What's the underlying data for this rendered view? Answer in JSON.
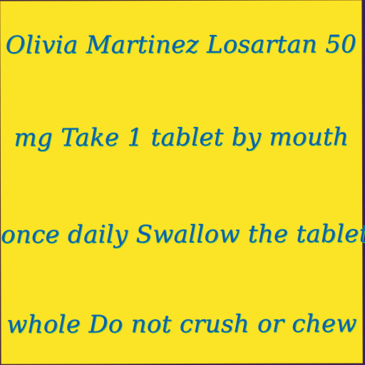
{
  "label": {
    "lines": [
      "Olivia Martinez Losartan 50",
      "mg Take 1 tablet by mouth",
      "once daily Swallow the tablet",
      "whole Do not crush or chew"
    ]
  },
  "colors": {
    "background": "#fbe325",
    "text": "#0f5fae",
    "text_outline": "#2fb88a",
    "border": "#3a1d5c"
  }
}
